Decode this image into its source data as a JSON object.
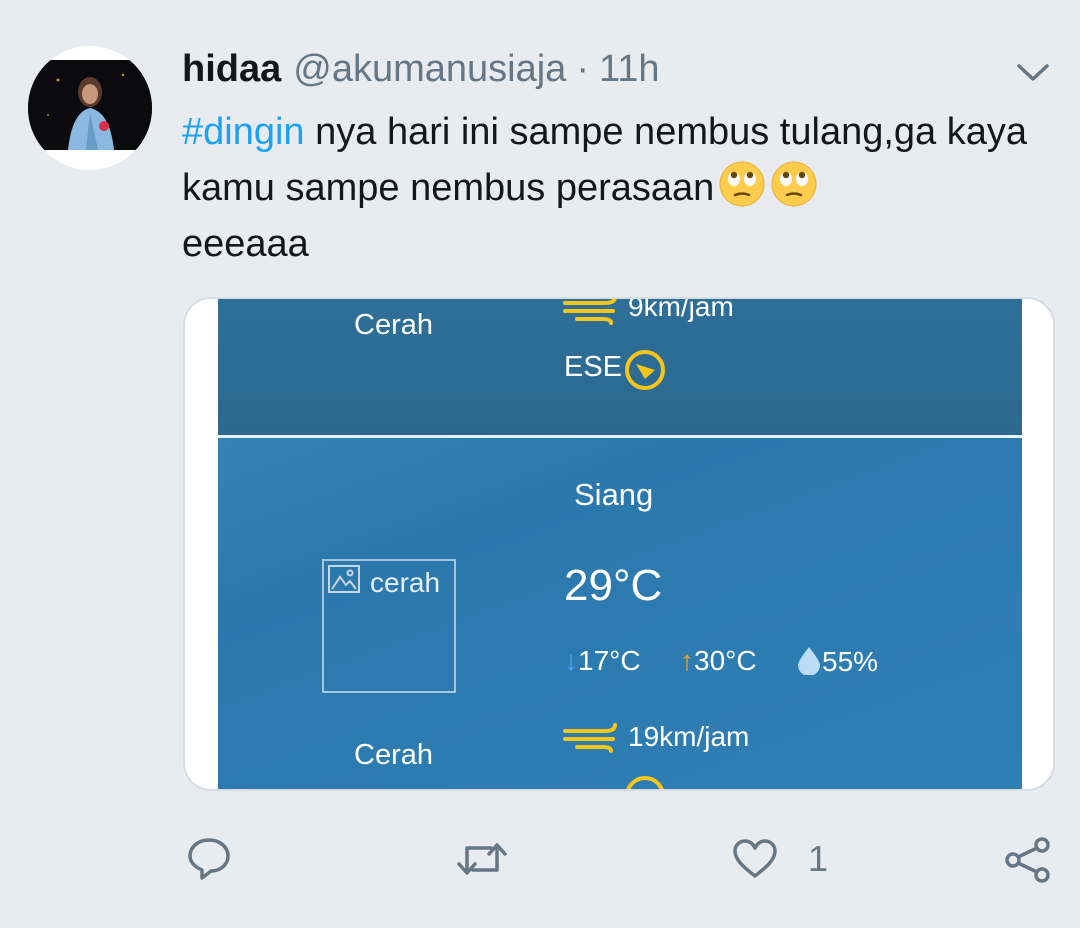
{
  "tweet": {
    "name": "hidaa",
    "handle": "@akumanusiaja",
    "separator": "·",
    "time": "11h",
    "hashtag": "#dingin",
    "text_part1": " nya hari ini sampe nembus tulang,ga kaya kamu sampe nembus perasaan",
    "text_part2": "eeeaaa",
    "emojis": [
      "face-with-rolling-eyes",
      "face-with-rolling-eyes"
    ]
  },
  "weather_card": {
    "top": {
      "condition": "Cerah",
      "wind_speed": "9km/jam",
      "wind_direction": "ESE"
    },
    "main": {
      "period": "Siang",
      "image_alt": "cerah",
      "temperature": "29°C",
      "min_temp": "17°C",
      "max_temp": "30°C",
      "humidity": "55%",
      "condition": "Cerah",
      "wind_speed": "19km/jam"
    },
    "colors": {
      "accent_yellow": "#f5c518",
      "min_arrow": "#4aa3f0",
      "max_arrow": "#f5a623",
      "drop": "#bcdcf5"
    }
  },
  "actions": {
    "reply_icon": "reply-icon",
    "retweet_icon": "retweet-icon",
    "like_icon": "heart-icon",
    "like_count": "1",
    "share_icon": "share-icon"
  },
  "colors": {
    "link": "#1da1f2",
    "secondary_text": "#657786",
    "background": "#e8ecf0"
  }
}
